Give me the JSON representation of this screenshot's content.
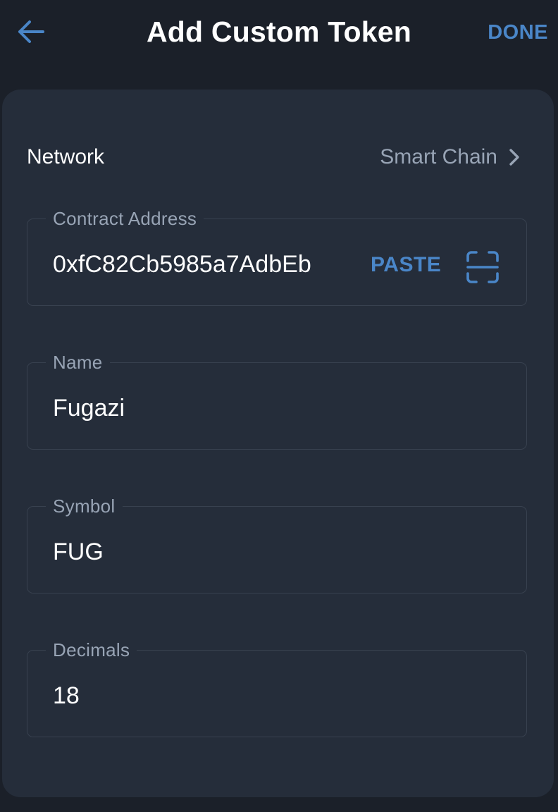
{
  "header": {
    "title": "Add Custom Token",
    "done_label": "DONE",
    "back_icon": "arrow-left-icon"
  },
  "network": {
    "label": "Network",
    "value": "Smart Chain",
    "chevron_icon": "chevron-right-icon"
  },
  "fields": {
    "contract_address": {
      "label": "Contract Address",
      "value": "0xfC82Cb5985a7AdbEb",
      "paste_label": "PASTE",
      "scan_icon": "qr-scan-icon"
    },
    "name": {
      "label": "Name",
      "value": "Fugazi"
    },
    "symbol": {
      "label": "Symbol",
      "value": "FUG"
    },
    "decimals": {
      "label": "Decimals",
      "value": "18"
    }
  },
  "colors": {
    "background": "#1b2029",
    "card": "#252d3a",
    "accent": "#4a86c8",
    "muted_text": "#98a4b5",
    "border": "#38414f"
  }
}
